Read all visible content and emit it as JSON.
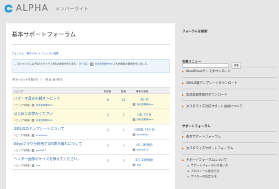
{
  "header": {
    "logo_text": "ALPHA",
    "subtitle": "メンバーサイト",
    "logo_color": "#2aa3d8"
  },
  "main": {
    "title": "基本サポートフォーラム",
    "breadcrumb": "フォーラム › 基本サポートフォーラム概要",
    "notice": {
      "prefix": "このトピックには7件のトピックと8件の返信があります。",
      "time": "4日 前",
      "middle": "に",
      "user": "永未忠明様Hero",
      "suffix": "さんが最後の更新を行いました。"
    },
    "count": "7件のトピックを表示中 - 1 - 7件目 (全7件中)",
    "table": {
      "headers": {
        "topic": "トピック",
        "voices": "参加者",
        "posts": "投稿",
        "freshness": "最後の投稿"
      },
      "rows": [
        {
          "title": "バグ・不具合の報告トピック",
          "meta": "トピック作成者:",
          "author": "永未忠明様Hero",
          "voices": "6",
          "posts": "11",
          "time": "4日 前",
          "last_user": "永未忠明様Hero",
          "sticky": true
        },
        {
          "title": "はじめにお読みください",
          "meta": "トピック作成者:",
          "author": "永未忠明様Hero",
          "voices": "1",
          "posts": "1",
          "time": "1週, 2日 前",
          "last_user": "永未忠明様Hero",
          "sticky": true
        },
        {
          "title": "SIRIUSのテンプレートについて",
          "meta": "トピック作成者:",
          "author": "asahikono",
          "voices": "1",
          "posts": "1",
          "time": "12時間, 37分 前",
          "last_user": "asahikono",
          "sticky": false
        },
        {
          "title": "Edgeブラウザ使用でのR表示崩れについて",
          "meta": "トピック作成者:",
          "author": "gouS014",
          "voices": "2",
          "posts": "3",
          "time": "4日, 3時間前",
          "last_user": "gouhii014",
          "sticky": false
        },
        {
          "title": "ヘッダー画像のサイズを教えてください。",
          "meta": "トピック作成者:",
          "author": "aria",
          "voices": "2",
          "posts": "3",
          "time": "5日, 18時間前",
          "last_user": "aria",
          "sticky": false
        }
      ]
    }
  },
  "sidebar": {
    "search_heading": "フォーラムを検索",
    "search_placeholder": "",
    "search_button": "検索",
    "members_heading": "会員メニュー",
    "members_links": [
      "WordPressテーマダウンロード",
      "SIRIUS版テンプレートダウンロード",
      "高品質画像素材ダウンロード",
      "カスタマイズ対応サポート会員について"
    ],
    "forum_heading": "サポートフォーラム",
    "forum_links": [
      "基本サポートフォーラム",
      "カスタマイズサポートフォーラム",
      "サポートフォーラムについて"
    ],
    "forum_sublinks": [
      "サポートフォーラムの使い方",
      "プロフィール設定方法",
      "アバターの設定方法"
    ]
  }
}
